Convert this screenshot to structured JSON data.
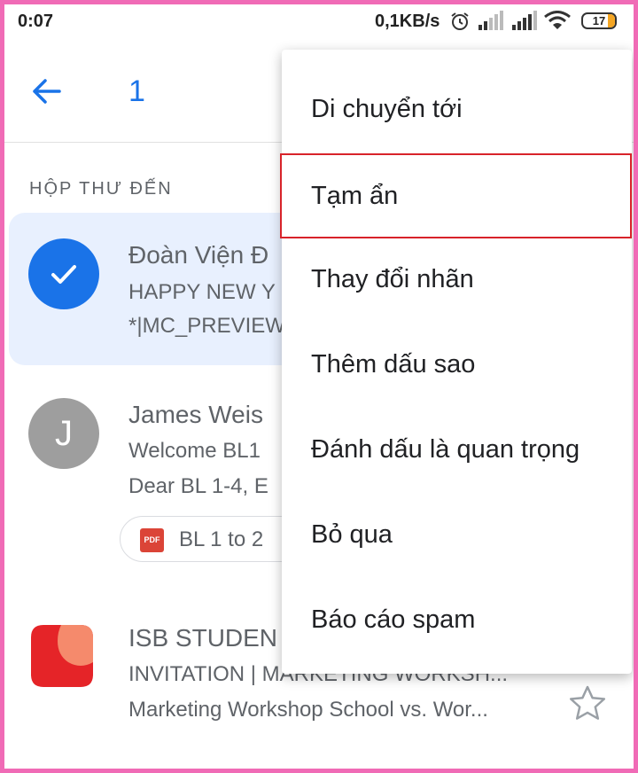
{
  "status_bar": {
    "time": "0:07",
    "net_speed": "0,1KB/s",
    "battery": "17"
  },
  "app_bar": {
    "selected_count": "1"
  },
  "inbox": {
    "section_label": "HỘP THƯ ĐẾN",
    "emails": [
      {
        "sender": "Đoàn Viện Đ",
        "subject": "HAPPY NEW Y",
        "preview": "*|MC_PREVIEW",
        "selected": true
      },
      {
        "avatar_letter": "J",
        "sender": "James Weis",
        "subject": "Welcome BL1",
        "preview": "Dear BL 1-4, E",
        "attachment": "BL 1 to 2"
      },
      {
        "sender": "ISB STUDEN",
        "subject": "INVITATION | MARKETING WORKSH...",
        "preview": "Marketing Workshop School vs. Wor..."
      }
    ]
  },
  "menu": {
    "items": [
      {
        "label": "Di chuyển tới"
      },
      {
        "label": "Tạm ẩn",
        "highlighted": true
      },
      {
        "label": "Thay đổi nhãn"
      },
      {
        "label": "Thêm dấu sao"
      },
      {
        "label": "Đánh dấu là quan trọng"
      },
      {
        "label": "Bỏ qua"
      },
      {
        "label": "Báo cáo spam"
      }
    ]
  },
  "colors": {
    "accent": "#1a73e8",
    "selected_bg": "#e8f0fe",
    "highlight_border": "#d8232a",
    "frame": "#f06bb6"
  }
}
